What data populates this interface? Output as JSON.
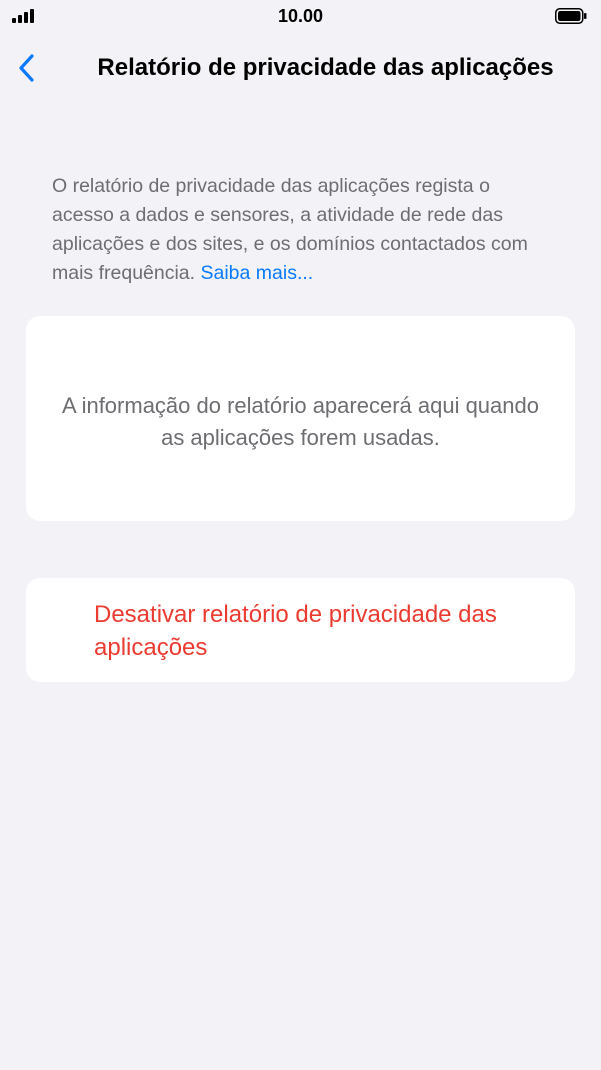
{
  "status_bar": {
    "time": "10.00",
    "signal_icon": "cellular-signal-icon",
    "battery_icon": "battery-full-icon"
  },
  "nav": {
    "back_icon": "chevron-left-icon",
    "title": "Relatório de privacidade das aplicações"
  },
  "description": {
    "text": "O relatório de privacidade das aplicações regista o acesso a dados e sensores, a atividade de rede das aplicações e dos sites, e os domínios contactados com mais frequência.",
    "link_label": "Saiba mais..."
  },
  "report": {
    "placeholder": "A informação do relatório aparecerá aqui quando as aplicações forem usadas."
  },
  "actions": {
    "disable_label": "Desativar relatório de privacidade das aplicações"
  },
  "colors": {
    "background": "#f2f2f7",
    "link": "#0a7aff",
    "destructive": "#eb3b30",
    "secondary_text": "#6d6d72"
  }
}
